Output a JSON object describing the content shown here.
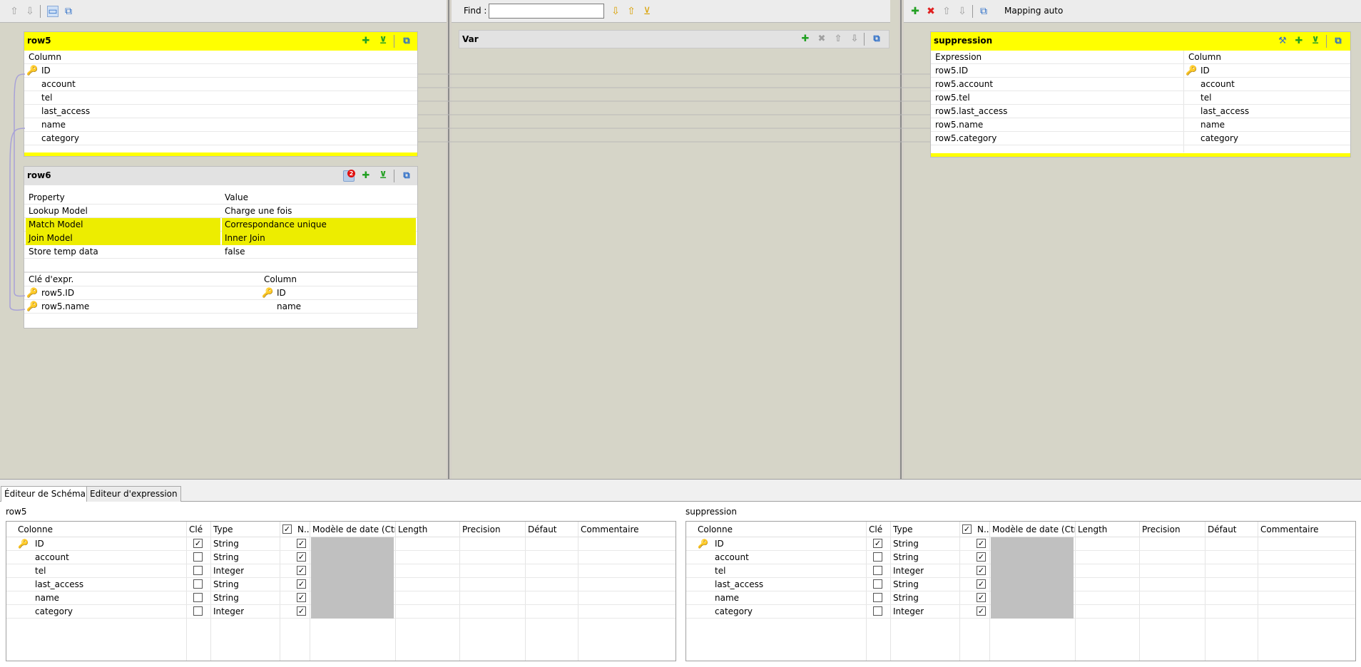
{
  "left_toolbar": {
    "icons": [
      "arrow-up-icon",
      "arrow-down-icon",
      "window-icon",
      "monitor-icon"
    ]
  },
  "mid_toolbar": {
    "find_label": "Find :",
    "find_value": "",
    "icons": [
      "arrow-down-icon",
      "arrow-up-icon",
      "filter-icon"
    ]
  },
  "right_toolbar": {
    "mapping_auto": "Mapping auto",
    "icons": [
      "add-icon",
      "delete-icon",
      "arrow-up-icon",
      "arrow-down-icon",
      "monitor-icon"
    ]
  },
  "row5": {
    "title": "row5",
    "column_header": "Column",
    "columns": [
      "ID",
      "account",
      "tel",
      "last_access",
      "name",
      "category"
    ]
  },
  "row6": {
    "title": "row6",
    "badge": "2",
    "property_header": "Property",
    "value_header": "Value",
    "properties": [
      {
        "property": "Lookup Model",
        "value": "Charge une fois"
      },
      {
        "property": "Match Model",
        "value": "Correspondance unique"
      },
      {
        "property": "Join Model",
        "value": "Inner Join"
      },
      {
        "property": "Store temp data",
        "value": "false"
      }
    ],
    "expr_header": "Clé d'expr.",
    "column_header": "Column",
    "keys": [
      {
        "expr": "row5.ID",
        "column": "ID"
      },
      {
        "expr": "row5.name",
        "column": "name"
      }
    ]
  },
  "var": {
    "title": "Var"
  },
  "suppression": {
    "title": "suppression",
    "expression_header": "Expression",
    "column_header": "Column",
    "rows": [
      {
        "expr": "row5.ID",
        "column": "ID"
      },
      {
        "expr": "row5.account",
        "column": "account"
      },
      {
        "expr": "row5.tel",
        "column": "tel"
      },
      {
        "expr": "row5.last_access",
        "column": "last_access"
      },
      {
        "expr": "row5.name",
        "column": "name"
      },
      {
        "expr": "row5.category",
        "column": "category"
      }
    ]
  },
  "tabs": [
    "Éditeur de  Schéma",
    "Editeur d'expression"
  ],
  "schema_headers": [
    "Colonne",
    "Clé",
    "Type",
    "N..",
    "Modèle de date (Ctrl+Es...",
    "Length",
    "Precision",
    "Défaut",
    "Commentaire"
  ],
  "schema_left": {
    "title": "row5",
    "rows": [
      {
        "name": "ID",
        "key": true,
        "type": "String",
        "nullable": true
      },
      {
        "name": "account",
        "key": false,
        "type": "String",
        "nullable": true
      },
      {
        "name": "tel",
        "key": false,
        "type": "Integer",
        "nullable": true
      },
      {
        "name": "last_access",
        "key": false,
        "type": "String",
        "nullable": true
      },
      {
        "name": "name",
        "key": false,
        "type": "String",
        "nullable": true
      },
      {
        "name": "category",
        "key": false,
        "type": "Integer",
        "nullable": true
      }
    ]
  },
  "schema_right": {
    "title": "suppression",
    "rows": [
      {
        "name": "ID",
        "key": true,
        "type": "String",
        "nullable": true
      },
      {
        "name": "account",
        "key": false,
        "type": "String",
        "nullable": true
      },
      {
        "name": "tel",
        "key": false,
        "type": "Integer",
        "nullable": true
      },
      {
        "name": "last_access",
        "key": false,
        "type": "String",
        "nullable": true
      },
      {
        "name": "name",
        "key": false,
        "type": "String",
        "nullable": true
      },
      {
        "name": "category",
        "key": false,
        "type": "Integer",
        "nullable": true
      }
    ]
  },
  "colors": {
    "highlight": "#ffff00",
    "panel_bg": "#d6d5c8"
  }
}
